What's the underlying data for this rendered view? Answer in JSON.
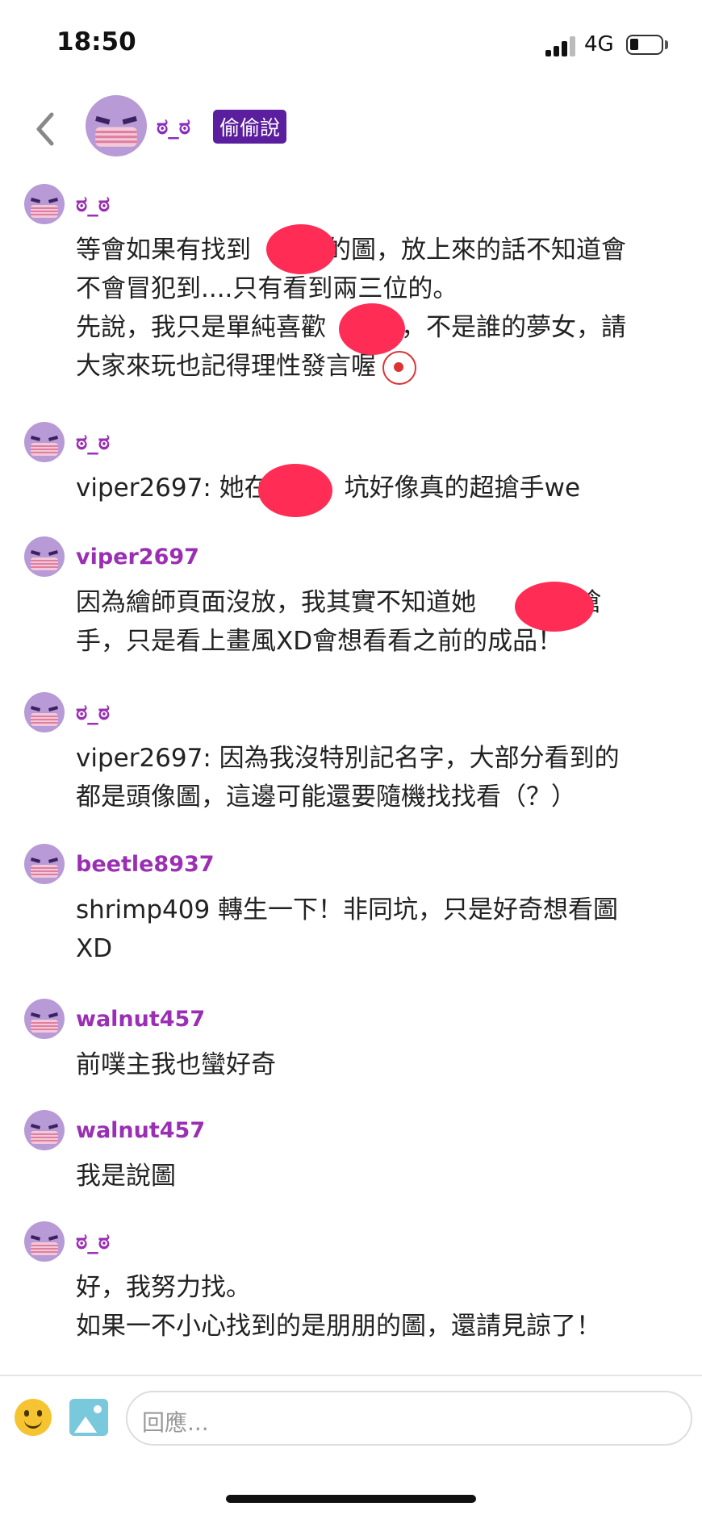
{
  "status": {
    "time": "18:50",
    "network": "4G"
  },
  "header": {
    "name": "ಠ_ಠ",
    "badge": "偷偷說"
  },
  "messages": [
    {
      "name": "ಠ_ಠ",
      "text": "等會如果有找到　　　的圖，放上來的話不知道會\n不會冒犯到....只有看到兩三位的。\n先說，我只是單純喜歡　　　，不是誰的夢女，請\n大家來玩也記得理性發言喔"
    },
    {
      "name": "ಠ_ಠ",
      "text": "viper2697: 她在　　　坑好像真的超搶手we"
    },
    {
      "name": "viper2697",
      "text": "因為繪師頁面沒放，我其實不知道她　　　坑搶\n手，只是看上畫風XD會想看看之前的成品！"
    },
    {
      "name": "ಠ_ಠ",
      "text": "viper2697: 因為我沒特別記名字，大部分看到的\n都是頭像圖，這邊可能還要隨機找找看（？）"
    },
    {
      "name": "beetle8937",
      "text": "shrimp409 轉生一下！非同坑，只是好奇想看圖\nXD"
    },
    {
      "name": "walnut457",
      "text": "前噗主我也蠻好奇"
    },
    {
      "name": "walnut457",
      "text": "我是說圖"
    },
    {
      "name": "ಠ_ಠ",
      "text": "好，我努力找。\n如果一不小心找到的是朋朋的圖，還請見諒了！"
    }
  ],
  "input": {
    "placeholder": "回應..."
  }
}
